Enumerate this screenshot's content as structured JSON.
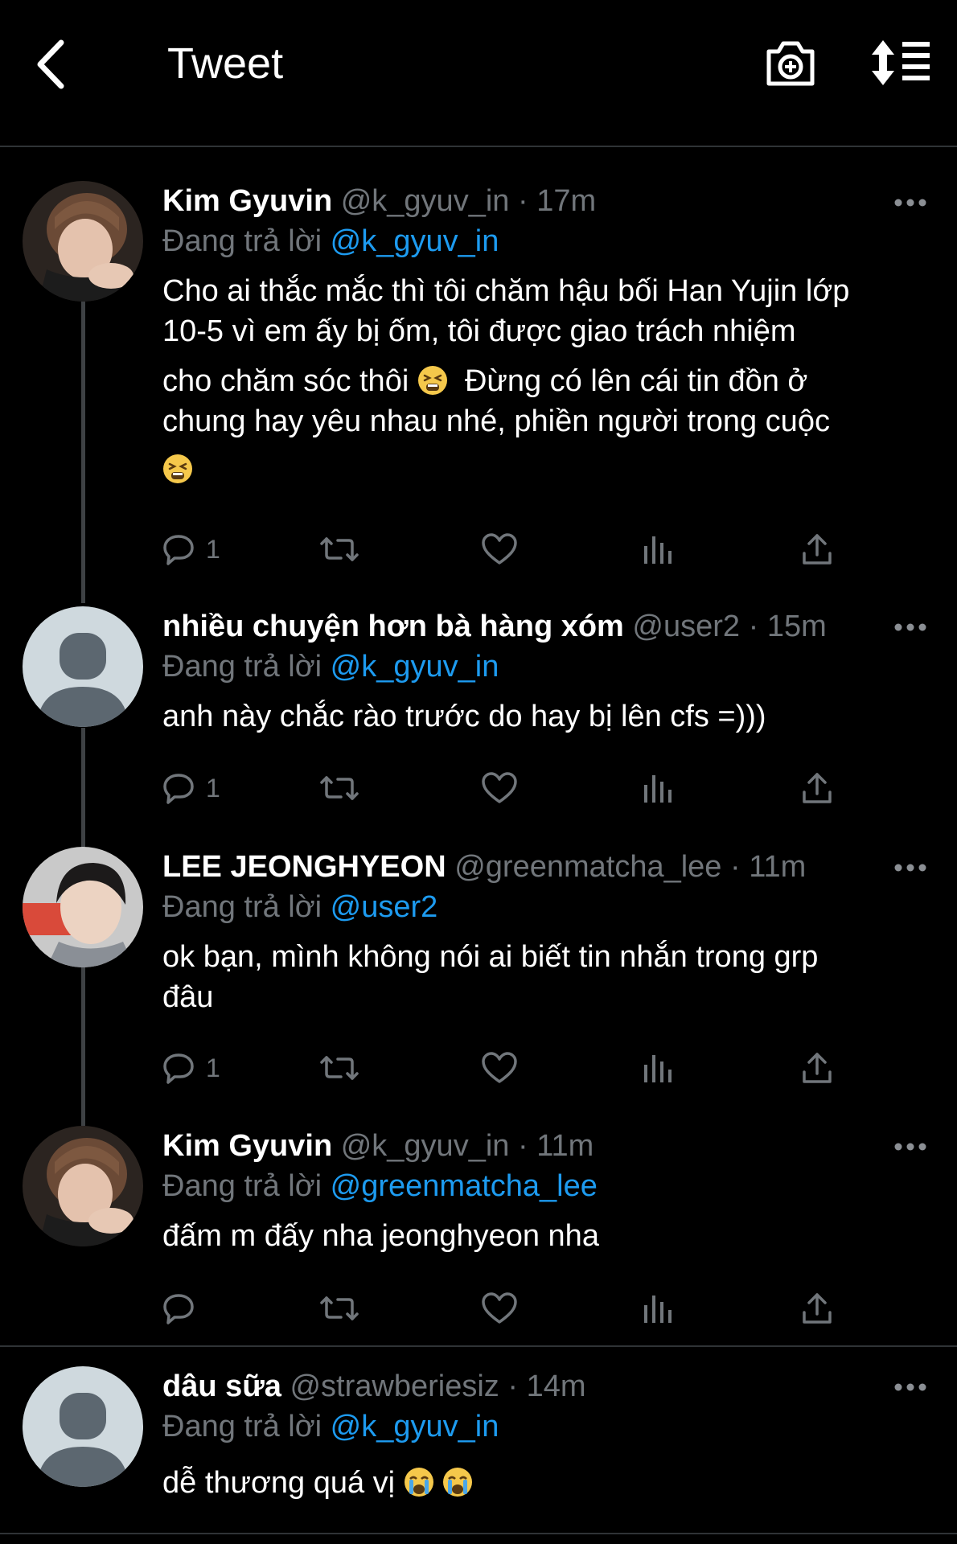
{
  "header": {
    "title": "Tweet"
  },
  "tweets": [
    {
      "name": "Kim Gyuvin",
      "handle": "@k_gyuv_in",
      "time": "17m",
      "reply_prefix": "Đang trả lời",
      "reply_to": "@k_gyuv_in",
      "text": [
        "Cho ai thắc mắc thì tôi chăm hậu bối Han Yujin lớp",
        "10-5 vì em ấy bị ốm, tôi được giao trách nhiệm",
        "cho chăm sóc thôi",
        "Đừng có lên cái tin đồn ở",
        "chung hay yêu nhau nhé, phiền người trong cuộc"
      ],
      "emoji": "tired-face",
      "reply_count": "1"
    },
    {
      "name": "nhiều chuyện hơn bà hàng xóm",
      "handle": "@user2",
      "time": "15m",
      "reply_prefix": "Đang trả lời",
      "reply_to": "@k_gyuv_in",
      "text": "anh này chắc rào trước do hay bị lên cfs =)))",
      "reply_count": "1"
    },
    {
      "name": "LEE JEONGHYEON",
      "handle": "@greenmatcha_lee",
      "time": "11m",
      "reply_prefix": "Đang trả lời",
      "reply_to": "@user2",
      "text": [
        "ok bạn, mình không nói ai biết tin nhắn trong grp",
        "đâu"
      ],
      "reply_count": "1"
    },
    {
      "name": "Kim Gyuvin",
      "handle": "@k_gyuv_in",
      "time": "11m",
      "reply_prefix": "Đang trả lời",
      "reply_to": "@greenmatcha_lee",
      "text": "đấm m đấy nha jeonghyeon nha",
      "reply_count": ""
    },
    {
      "name": "dâu sữa",
      "handle": "@strawberiesiz",
      "time": "14m",
      "reply_prefix": "Đang trả lời",
      "reply_to": "@k_gyuv_in",
      "text": "dễ thương quá vị",
      "emoji": "crying-face"
    }
  ],
  "colors": {
    "background": "#000000",
    "accent": "#1d9bf0",
    "secondary": "#71767b",
    "divider": "#2f3336"
  },
  "icons": [
    "back-arrow-icon",
    "camera-add-icon",
    "sort-icon",
    "more-icon",
    "reply-icon",
    "retweet-icon",
    "like-icon",
    "analytics-icon",
    "share-icon",
    "default-avatar-icon"
  ]
}
